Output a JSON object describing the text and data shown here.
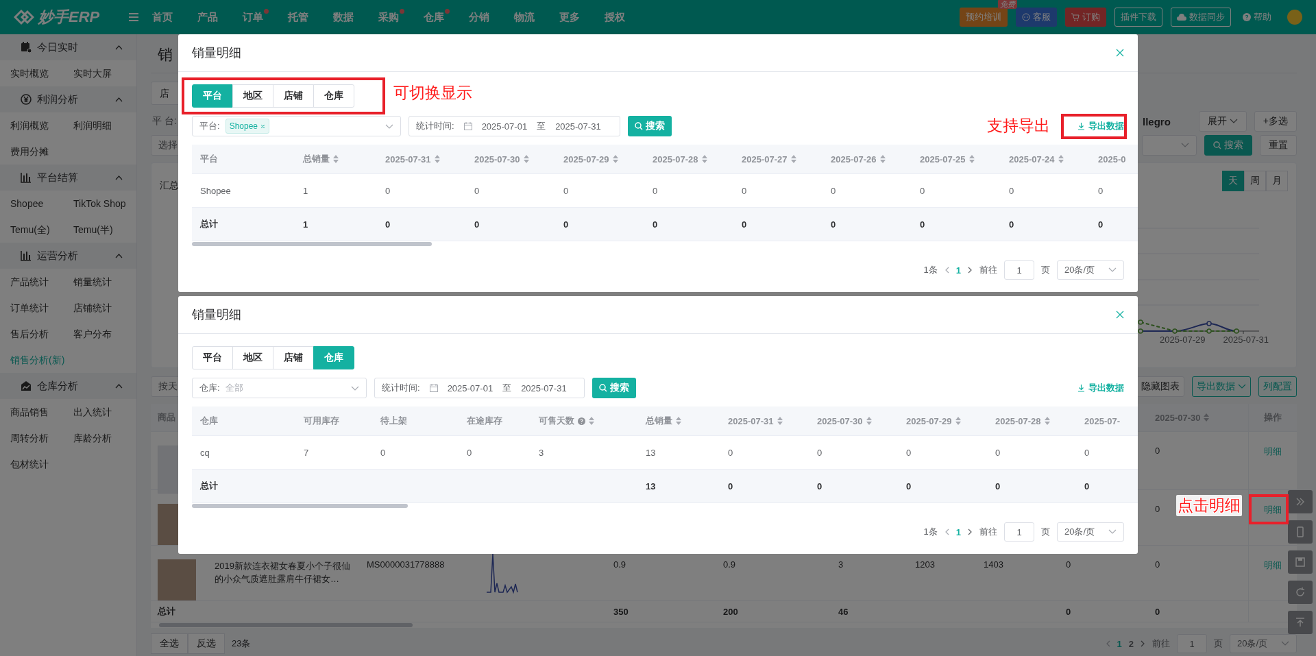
{
  "top_nav": {
    "logo": "妙手ERP",
    "items": [
      {
        "label": "首页",
        "dot": false
      },
      {
        "label": "产品",
        "dot": false
      },
      {
        "label": "订单",
        "dot": true
      },
      {
        "label": "托管",
        "dot": false
      },
      {
        "label": "数据",
        "dot": false
      },
      {
        "label": "采购",
        "dot": true
      },
      {
        "label": "仓库",
        "dot": true
      },
      {
        "label": "分销",
        "dot": false
      },
      {
        "label": "物流",
        "dot": false
      },
      {
        "label": "更多",
        "dot": false
      },
      {
        "label": "授权",
        "dot": false
      }
    ],
    "actions": [
      {
        "kind": "training",
        "label": "预约培训",
        "badge": "免费"
      },
      {
        "kind": "service",
        "label": "客服"
      },
      {
        "kind": "order",
        "label": "订购"
      },
      {
        "kind": "outline",
        "label": "插件下载"
      },
      {
        "kind": "sync",
        "label": "数据同步"
      },
      {
        "kind": "help",
        "label": "帮助"
      }
    ]
  },
  "sidebar": {
    "groups": [
      {
        "title": "今日实时",
        "expanded": true,
        "items": [
          {
            "label": "实时概览",
            "selected": false
          },
          {
            "label": "实时大屏",
            "selected": false
          }
        ]
      },
      {
        "title": "利润分析",
        "expanded": true,
        "items": [
          {
            "label": "利润概览",
            "selected": false
          },
          {
            "label": "利润明细",
            "selected": false
          },
          {
            "label": "费用分摊",
            "selected": false
          }
        ]
      },
      {
        "title": "平台结算",
        "expanded": true,
        "items": [
          {
            "label": "Shopee",
            "selected": false
          },
          {
            "label": "TikTok Shop",
            "selected": false
          },
          {
            "label": "Temu(全)",
            "selected": false
          },
          {
            "label": "Temu(半)",
            "selected": false
          }
        ]
      },
      {
        "title": "运营分析",
        "expanded": true,
        "items": [
          {
            "label": "产品统计",
            "selected": false
          },
          {
            "label": "销量统计",
            "selected": false
          },
          {
            "label": "订单统计",
            "selected": false
          },
          {
            "label": "店铺统计",
            "selected": false
          },
          {
            "label": "售后分析",
            "selected": false
          },
          {
            "label": "客户分布",
            "selected": false
          },
          {
            "label": "销售分析(新)",
            "selected": true
          }
        ]
      },
      {
        "title": "仓库分析",
        "expanded": true,
        "items": [
          {
            "label": "商品销售",
            "selected": false
          },
          {
            "label": "出入统计",
            "selected": false
          },
          {
            "label": "周转分析",
            "selected": false
          },
          {
            "label": "库龄分析",
            "selected": false
          },
          {
            "label": "包材统计",
            "selected": false
          }
        ]
      }
    ]
  },
  "page": {
    "title": "销",
    "tab": "店",
    "platform_label": "平 台:",
    "platform_value": "llegro",
    "expand_button": "展开",
    "multi_button": "+多选",
    "shop_select": "选择",
    "search_button": "搜索",
    "reset_button": "重置",
    "summary": {
      "title": "汇总",
      "periods": [
        {
          "label": "天",
          "selected": true
        },
        {
          "label": "周",
          "selected": false
        },
        {
          "label": "月",
          "selected": false
        }
      ],
      "x_labels": [
        "2025-07-29",
        "2025-07-31"
      ]
    },
    "group_select": "按天",
    "hide_chart_button": "隐藏图表",
    "export_button": "导出数据",
    "columns_button": "列配置",
    "table": {
      "product_header": "商品",
      "date_header": "2025-07-30",
      "action_header": "操作",
      "rows": [
        {
          "kind": "placeholder",
          "date_value": "0",
          "action": "明细"
        },
        {
          "kind": "photo",
          "date_value": "0",
          "action": "明细"
        },
        {
          "kind": "photo",
          "name": "2019新款连衣裙女春夏小个子很仙的小众气质遮肚露肩牛仔裙女…",
          "sku": "MS0000031778888",
          "values": [
            "0.9",
            "0.9",
            "3",
            "1203",
            "1403",
            "0",
            "0"
          ],
          "action": "明细"
        }
      ],
      "total": {
        "label": "总计",
        "values": [
          "350",
          "200",
          "46"
        ],
        "tail_values": [
          "0",
          "0"
        ]
      }
    },
    "footer": {
      "select_all": "全选",
      "invert": "反选",
      "count": "23条",
      "pages": [
        {
          "label": "1",
          "selected": true
        },
        {
          "label": "2",
          "selected": false
        }
      ],
      "goto_label": "前往",
      "page_input": "1",
      "page_unit": "页",
      "page_size": "20条/页"
    }
  },
  "dialogs": [
    {
      "title": "销量明细",
      "tabs": [
        {
          "label": "平台",
          "selected": true
        },
        {
          "label": "地区",
          "selected": false
        },
        {
          "label": "店铺",
          "selected": false
        },
        {
          "label": "仓库",
          "selected": false
        }
      ],
      "filter": {
        "label": "平台:",
        "tag": "Shopee"
      },
      "date": {
        "label": "统计时间:",
        "start": "2025-07-01",
        "separator": "至",
        "end": "2025-07-31"
      },
      "search_button": "搜索",
      "export_button": "导出数据",
      "table": {
        "columns": [
          {
            "label": "平台",
            "sortable": false,
            "help": false
          },
          {
            "label": "总销量",
            "sortable": true,
            "help": false
          },
          {
            "label": "2025-07-31",
            "sortable": true,
            "help": false
          },
          {
            "label": "2025-07-30",
            "sortable": true,
            "help": false
          },
          {
            "label": "2025-07-29",
            "sortable": true,
            "help": false
          },
          {
            "label": "2025-07-28",
            "sortable": true,
            "help": false
          },
          {
            "label": "2025-07-27",
            "sortable": true,
            "help": false
          },
          {
            "label": "2025-07-26",
            "sortable": true,
            "help": false
          },
          {
            "label": "2025-07-25",
            "sortable": true,
            "help": false
          },
          {
            "label": "2025-07-24",
            "sortable": true,
            "help": false
          },
          {
            "label": "2025-0",
            "sortable": false,
            "help": false
          }
        ],
        "rows": [
          [
            "Shopee",
            "1",
            "0",
            "0",
            "0",
            "0",
            "0",
            "0",
            "0",
            "0",
            "0"
          ]
        ],
        "total": {
          "label": "总计",
          "values": [
            "1",
            "0",
            "0",
            "0",
            "0",
            "0",
            "0",
            "0",
            "0",
            "0"
          ]
        }
      },
      "pagination": {
        "total": "1条",
        "pages": [
          {
            "label": "1",
            "selected": true
          }
        ],
        "goto_label": "前往",
        "page_input": "1",
        "page_unit": "页",
        "page_size": "20条/页"
      }
    },
    {
      "title": "销量明细",
      "tabs": [
        {
          "label": "平台",
          "selected": false
        },
        {
          "label": "地区",
          "selected": false
        },
        {
          "label": "店铺",
          "selected": false
        },
        {
          "label": "仓库",
          "selected": true
        }
      ],
      "filter": {
        "label": "仓库:",
        "placeholder": "全部"
      },
      "date": {
        "label": "统计时间:",
        "start": "2025-07-01",
        "separator": "至",
        "end": "2025-07-31"
      },
      "search_button": "搜索",
      "export_button": "导出数据",
      "table": {
        "columns": [
          {
            "label": "仓库",
            "sortable": false,
            "help": false
          },
          {
            "label": "可用库存",
            "sortable": false,
            "help": false
          },
          {
            "label": "待上架",
            "sortable": false,
            "help": false
          },
          {
            "label": "在途库存",
            "sortable": false,
            "help": false
          },
          {
            "label": "可售天数",
            "sortable": true,
            "help": true
          },
          {
            "label": "总销量",
            "sortable": true,
            "help": false
          },
          {
            "label": "2025-07-31",
            "sortable": true,
            "help": false
          },
          {
            "label": "2025-07-30",
            "sortable": true,
            "help": false
          },
          {
            "label": "2025-07-29",
            "sortable": true,
            "help": false
          },
          {
            "label": "2025-07-28",
            "sortable": true,
            "help": false
          },
          {
            "label": "2025-07-",
            "sortable": false,
            "help": false
          }
        ],
        "rows": [
          [
            "cq",
            "7",
            "0",
            "0",
            "3",
            "13",
            "0",
            "0",
            "0",
            "0",
            "0"
          ]
        ],
        "total": {
          "label": "总计",
          "values": [
            "13",
            "0",
            "0",
            "0",
            "0",
            "0"
          ]
        }
      },
      "pagination": {
        "total": "1条",
        "pages": [
          {
            "label": "1",
            "selected": true
          }
        ],
        "goto_label": "前往",
        "page_input": "1",
        "page_unit": "页",
        "page_size": "20条/页"
      }
    }
  ],
  "annotations": [
    {
      "text": "可切换显示"
    },
    {
      "text": "支持导出"
    },
    {
      "text": "点击明细"
    }
  ]
}
